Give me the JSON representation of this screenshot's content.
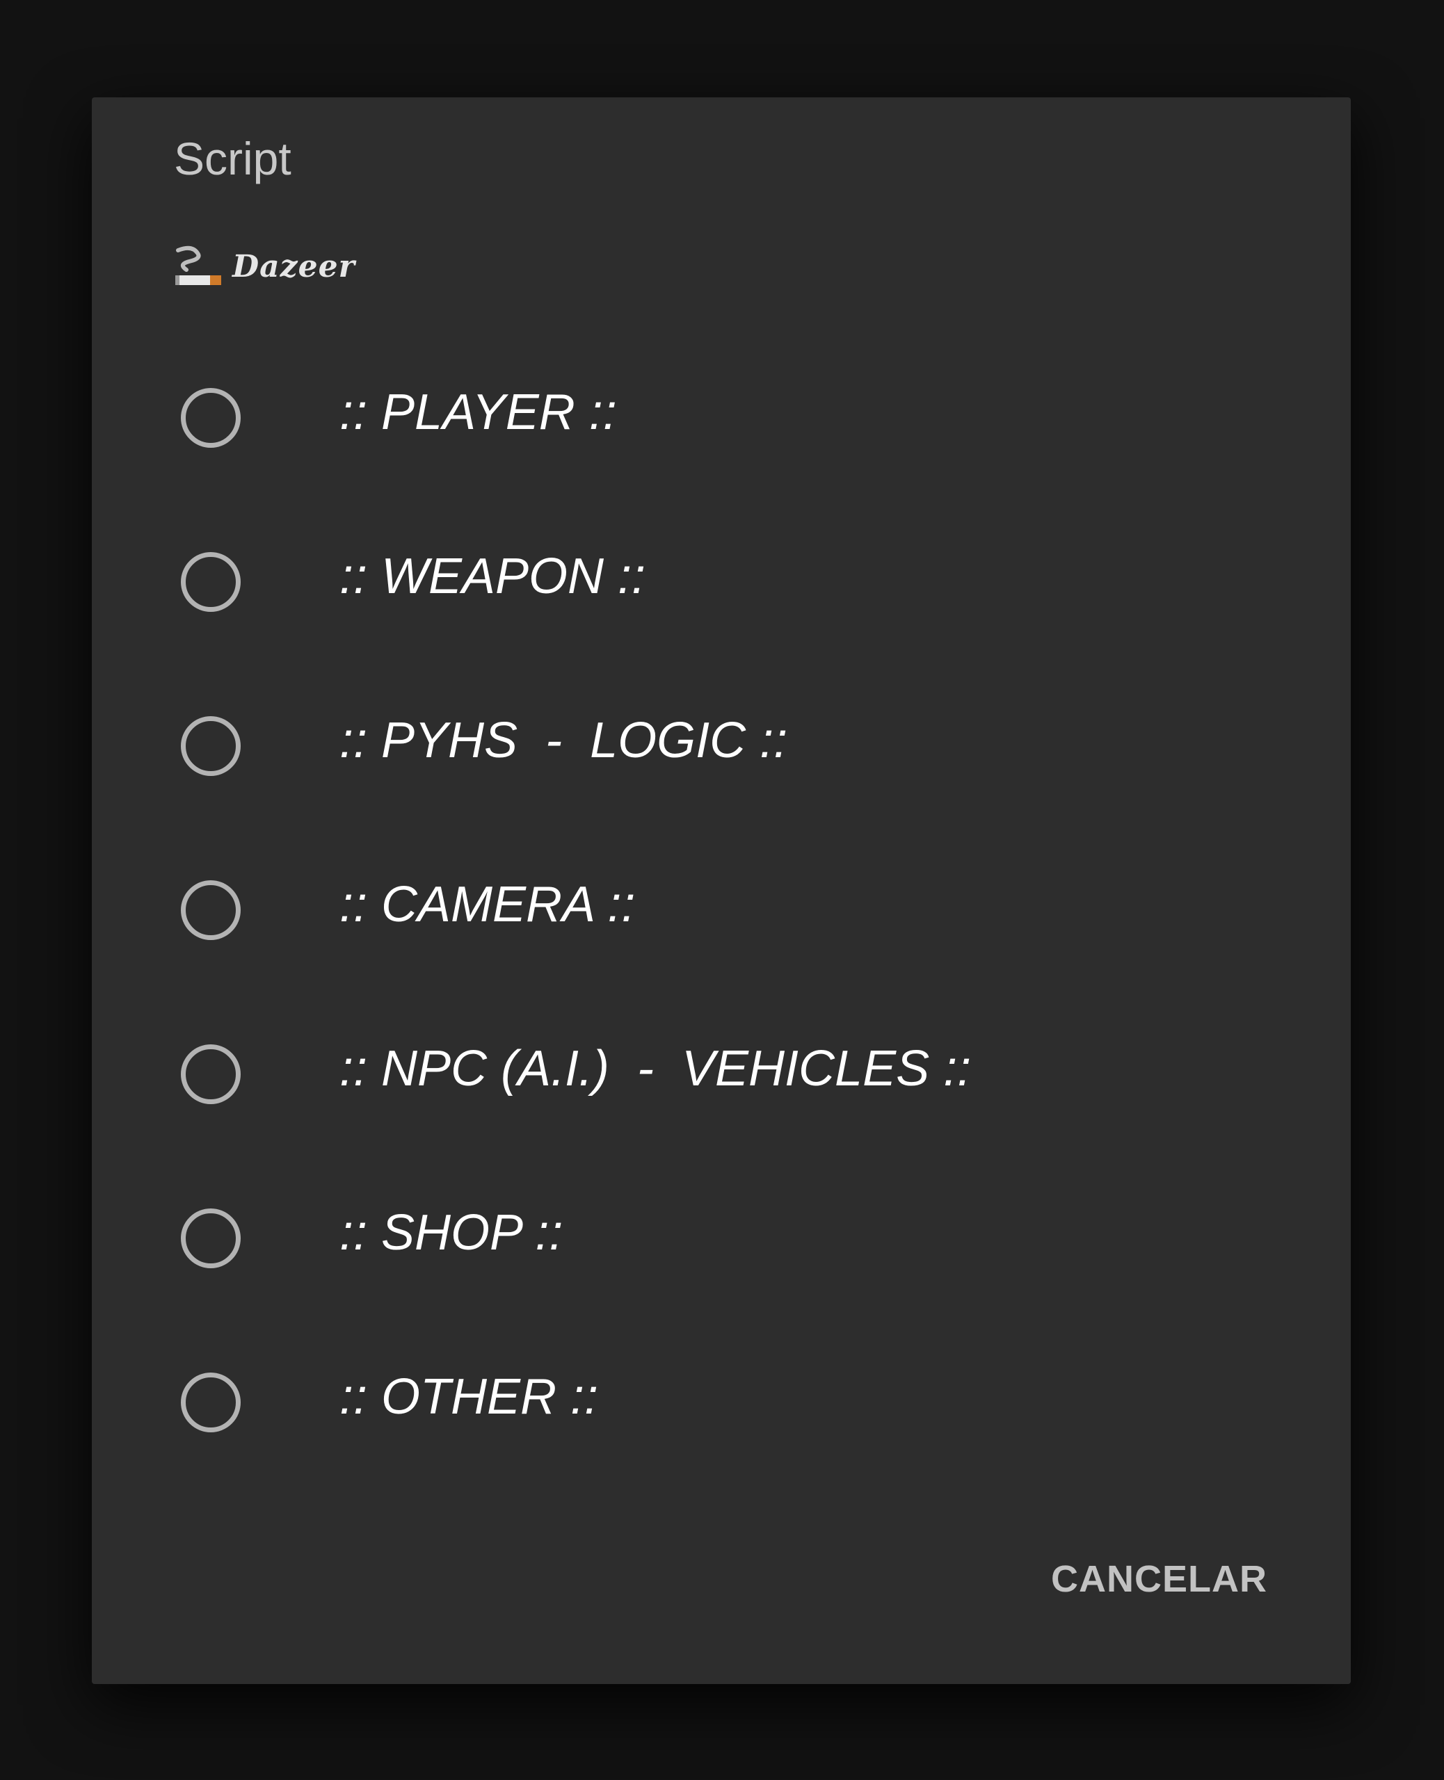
{
  "dialog": {
    "title": "Script",
    "subtitle": "Dazeer",
    "options": [
      {
        "label": ":: PLAYER ::",
        "selected": false
      },
      {
        "label": ":: WEAPON ::",
        "selected": false
      },
      {
        "label": ":: PYHS  -  LOGIC ::",
        "selected": false
      },
      {
        "label": ":: CAMERA ::",
        "selected": false
      },
      {
        "label": ":: NPC (A.I.)  -  VEHICLES ::",
        "selected": false
      },
      {
        "label": ":: SHOP ::",
        "selected": false
      },
      {
        "label": ":: OTHER ::",
        "selected": false
      }
    ],
    "cancel_label": "CANCELAR"
  },
  "icons": {
    "subtitle_icon": "cigarette-icon",
    "option_control": "radio-unchecked-icon"
  },
  "colors": {
    "dialog_background": "#2d2d2d",
    "screen_background": "#121212",
    "radio_ring": "#b3b3b3",
    "option_text": "#ffffff",
    "title_text": "#c8c8c8",
    "cancel_text": "#c2c2c2"
  }
}
